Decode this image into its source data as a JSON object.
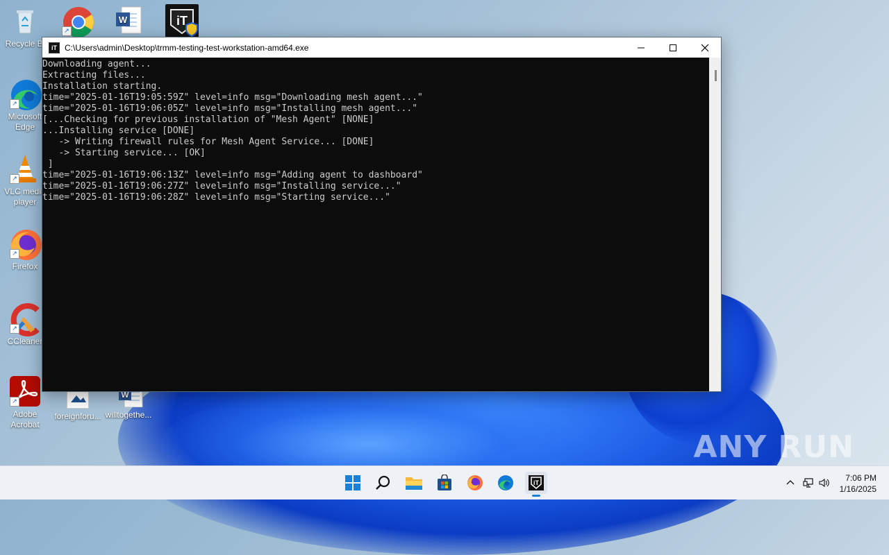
{
  "desktop": {
    "icons": [
      {
        "label": "Recycle Bin",
        "display": "Recycle Bi"
      },
      {
        "label": "Google Chrome",
        "display": ""
      },
      {
        "label": "Word document",
        "display": ""
      },
      {
        "label": "Tactical RMM",
        "display": ""
      },
      {
        "label": "Microsoft Edge",
        "display": "Microsoft Edge"
      },
      {
        "label": "VLC media player",
        "display": "VLC media player"
      },
      {
        "label": "Firefox",
        "display": "Firefox"
      },
      {
        "label": "CCleaner",
        "display": "CCleaner"
      },
      {
        "label": "Adobe Acrobat",
        "display": "Adobe Acrobat"
      },
      {
        "label": "foreignforu...",
        "display": "foreignforu..."
      },
      {
        "label": "willtogethe...",
        "display": "willtogethe..."
      }
    ]
  },
  "console_window": {
    "title": "C:\\Users\\admin\\Desktop\\trmm-testing-test-workstation-amd64.exe",
    "icon": "trmm-icon",
    "output": "Downloading agent...\nExtracting files...\nInstallation starting.\ntime=\"2025-01-16T19:05:59Z\" level=info msg=\"Downloading mesh agent...\"\ntime=\"2025-01-16T19:06:05Z\" level=info msg=\"Installing mesh agent...\"\n[...Checking for previous installation of \"Mesh Agent\" [NONE]\n...Installing service [DONE]\n   -> Writing firewall rules for Mesh Agent Service... [DONE]\n   -> Starting service... [OK]\n ]\ntime=\"2025-01-16T19:06:13Z\" level=info msg=\"Adding agent to dashboard\"\ntime=\"2025-01-16T19:06:27Z\" level=info msg=\"Installing service...\"\ntime=\"2025-01-16T19:06:28Z\" level=info msg=\"Starting service...\""
  },
  "taskbar": {
    "apps": [
      "start",
      "search",
      "file-explorer",
      "microsoft-store",
      "firefox",
      "edge",
      "trmm"
    ],
    "clock_time": "7:06 PM",
    "clock_date": "1/16/2025"
  },
  "watermark": "ANY RUN",
  "colors": {
    "console_bg": "#0c0c0c",
    "console_text": "#cccccc",
    "taskbar_bg": "#eef1f6",
    "wallpaper_blue": "#1f5fe8"
  }
}
